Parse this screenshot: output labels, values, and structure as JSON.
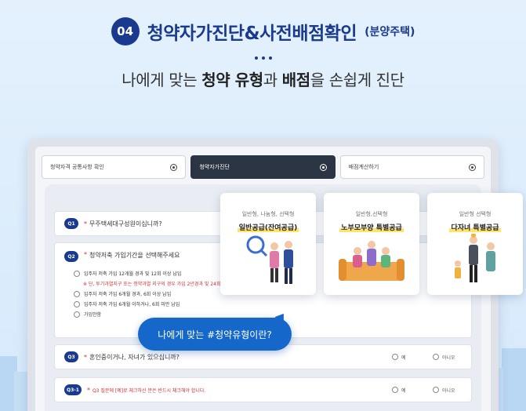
{
  "header": {
    "step": "04",
    "title": "청약자가진단&사전배점확인",
    "title_suffix": "(분양주택)",
    "subtitle_pre": "나에게 맞는 ",
    "subtitle_b1": "청약 유형",
    "subtitle_mid": "과 ",
    "subtitle_b2": "배점",
    "subtitle_post": "을 손쉽게 진단"
  },
  "tabs": [
    {
      "label": "청약자격 공통사항 확인"
    },
    {
      "label": "청약자가진단"
    },
    {
      "label": "배점계산하기"
    }
  ],
  "questions": {
    "q1": {
      "num": "Q1",
      "text": "무주택세대구성원이십니까?"
    },
    "q2": {
      "num": "Q2",
      "text": "청약저축 가입기간을 선택해주세요",
      "options": [
        "입주자 저축 가입 12개월 경과 및 12회 이상 납입",
        "입주자 저축 가입 6개월 경과, 6회 이상 납입",
        "입주자 저축 가입 6개월 이하거나, 6회 미만 납입",
        "가입안함"
      ],
      "note": "※ 단, 투기과열지구 또는 청약과열 지구의 경우 가입 2년경과 및 24회"
    },
    "q3": {
      "num": "Q3",
      "text": "혼인중이거나, 자녀가 있으십니까?",
      "yes": "예",
      "no": "아니오"
    },
    "q3_1": {
      "num": "Q3-1",
      "text": "Q3 질문에 [예]로 체크하신 분은 반드시 체크해야 합니다.",
      "yes": "예",
      "no": "아니오"
    }
  },
  "cards": [
    {
      "sub": "일반형, 나눔형, 선택형",
      "title": "일반공급(잔여공급)",
      "icon": "people-magnifier-icon"
    },
    {
      "sub": "일반형,선택형",
      "title": "노부모부양 특별공급",
      "icon": "family-sofa-icon"
    },
    {
      "sub": "일반형 선택형",
      "title": "다자녀 특별공급",
      "icon": "multichild-family-icon"
    }
  ],
  "callout": {
    "text": "나에게 맞는 #청약유형이란?"
  },
  "colors": {
    "brand": "#1a3a8f",
    "accent": "#1568c9",
    "alert": "#d32f2f"
  }
}
